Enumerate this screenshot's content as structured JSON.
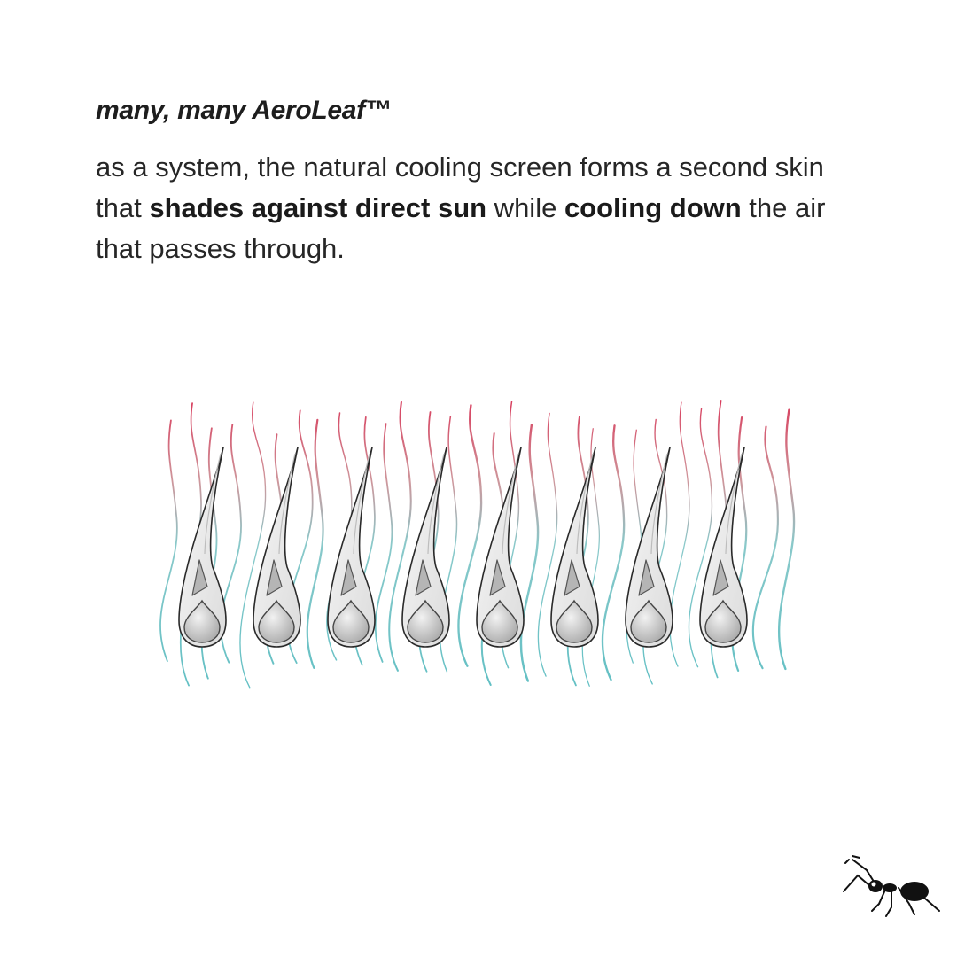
{
  "heading": "many, many AeroLeaf™",
  "paragraph": {
    "part1": "as a system, the natural cooling screen forms a second skin that ",
    "bold1": "shades against direct sun",
    "part2": " while ",
    "bold2": "cooling down",
    "part3": " the air that passes through."
  },
  "diagram": {
    "leaf_count": 8,
    "colors": {
      "warm_air": "#d4264a",
      "cool_air": "#4fb8bd",
      "leaf_outline": "#2a2a2a",
      "leaf_fill": "#eeeeee",
      "inner_shape": "#b5b5b5"
    }
  },
  "logo": {
    "icon": "ant-logo-icon"
  }
}
